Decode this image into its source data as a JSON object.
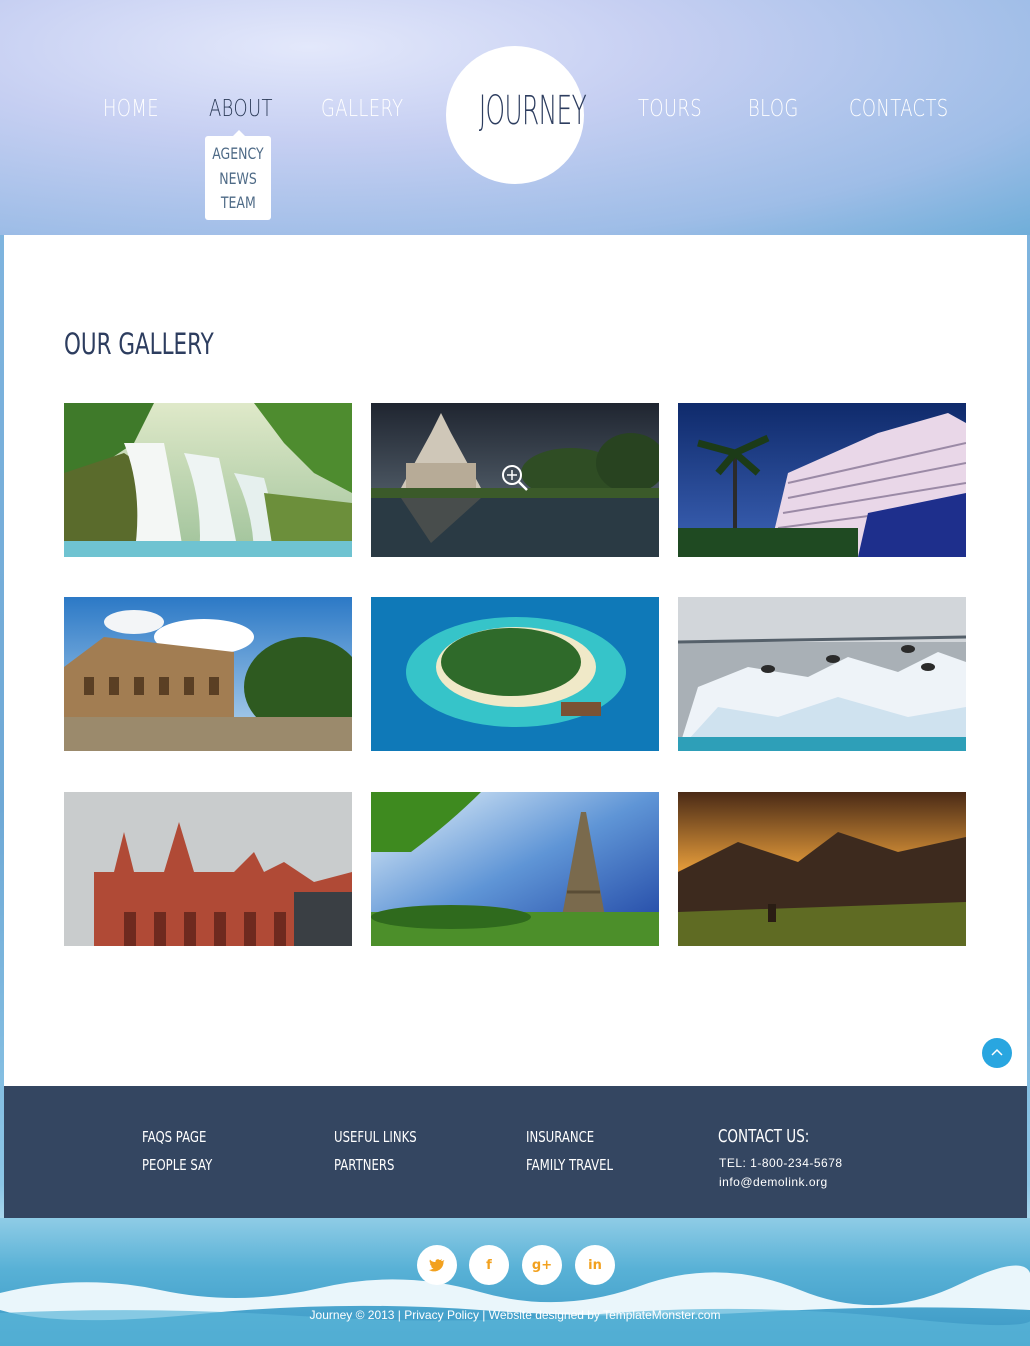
{
  "nav": {
    "left": [
      "HOME",
      "ABOUT",
      "GALLERY"
    ],
    "right": [
      "TOURS",
      "BLOG",
      "CONTACTS"
    ],
    "active": "ABOUT",
    "about_submenu": [
      "AGENCY",
      "NEWS",
      "TEAM"
    ]
  },
  "logo": "JOURNEY",
  "main": {
    "title": "OUR GALLERY",
    "gallery": [
      {
        "subject": "waterfall"
      },
      {
        "subject": "thai-temple-reflection"
      },
      {
        "subject": "beach-hotel-palms"
      },
      {
        "subject": "colosseum-rome"
      },
      {
        "subject": "tropical-island-aerial"
      },
      {
        "subject": "icebergs-gulls"
      },
      {
        "subject": "red-brick-bridge-berlin"
      },
      {
        "subject": "eiffel-tower"
      },
      {
        "subject": "mountain-valley-sunset"
      }
    ]
  },
  "footer": {
    "col1": [
      "FAQS PAGE",
      "PEOPLE SAY"
    ],
    "col2": [
      "USEFUL LINKS",
      "PARTNERS"
    ],
    "col3": [
      "INSURANCE",
      "FAMILY TRAVEL"
    ],
    "contact": {
      "heading": "CONTACT US:",
      "tel": "TEL: 1-800-234-5678",
      "email": "info@demolink.org"
    }
  },
  "social": [
    "twitter",
    "facebook",
    "google-plus",
    "linkedin"
  ],
  "copyright": {
    "brand": "Journey",
    "year_text": "© 2013 |",
    "privacy": "Privacy Policy",
    "designed": "| Website designed by",
    "designer": "TemplateMonster.com"
  },
  "colors": {
    "nav_active": "#2b3a57",
    "footer_bg": "#344661",
    "scroll_top": "#29a6e0",
    "social_icon": "#f2a11f"
  }
}
